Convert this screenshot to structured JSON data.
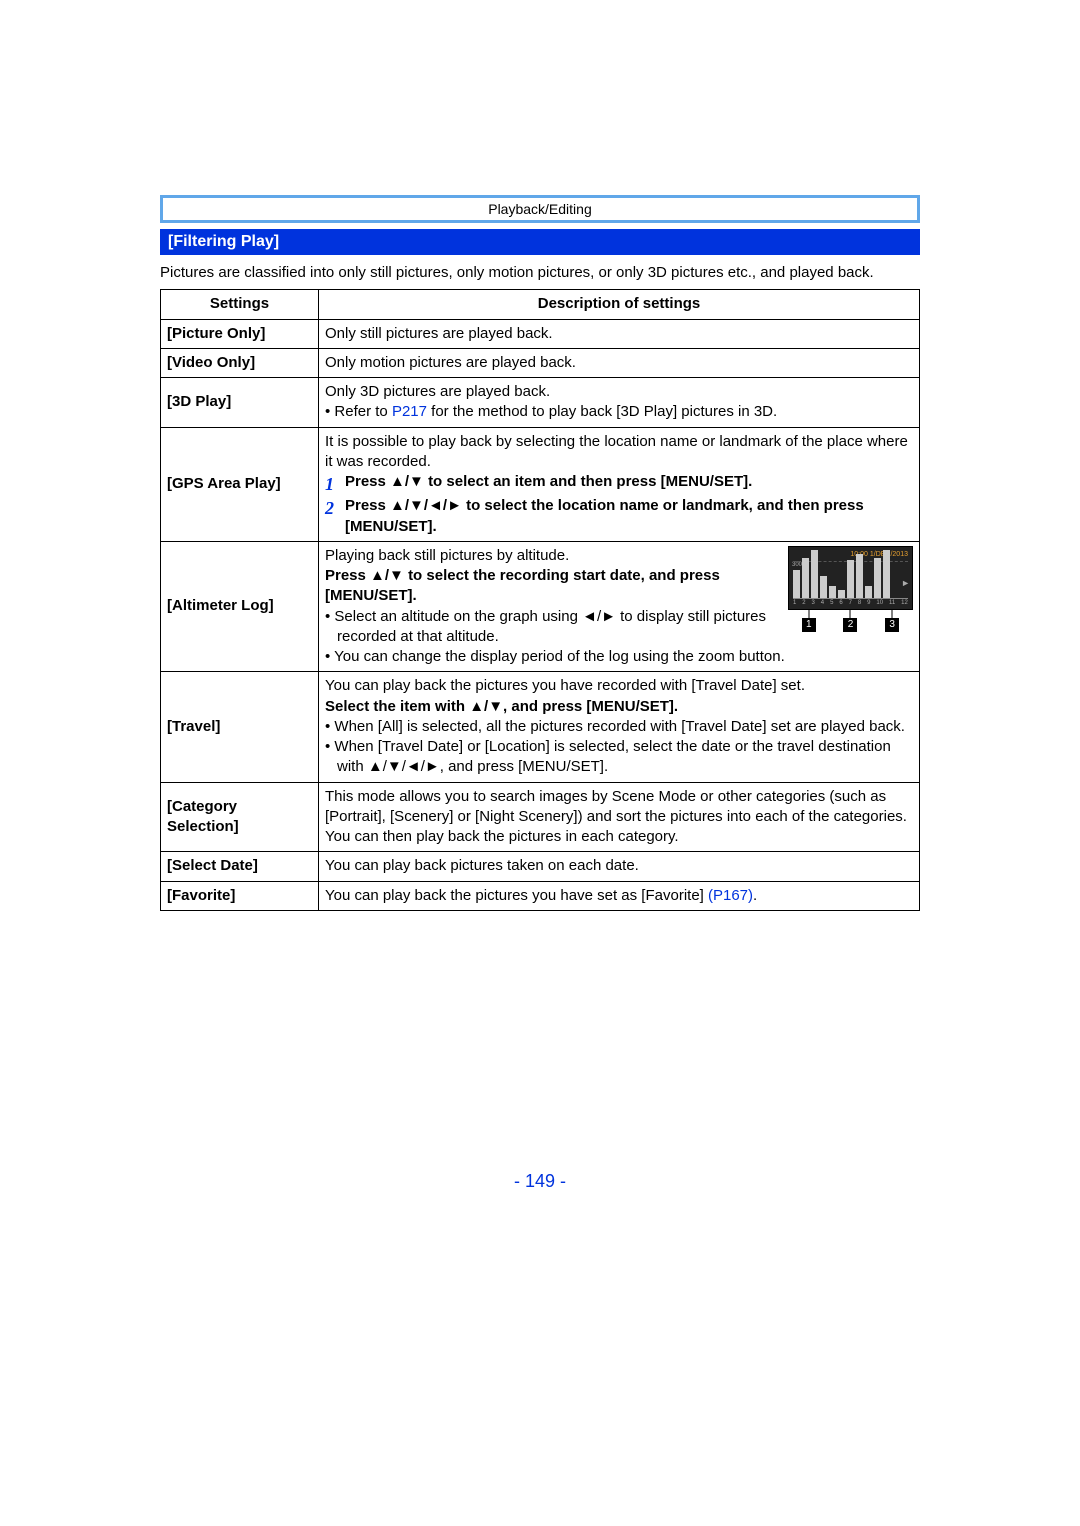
{
  "header": {
    "breadcrumb": "Playback/Editing"
  },
  "section": {
    "title": "[Filtering Play]"
  },
  "intro": "Pictures are classified into only still pictures, only motion pictures, or only 3D pictures etc., and played back.",
  "table": {
    "headers": {
      "settings": "Settings",
      "desc": "Description of settings"
    },
    "picture_only": {
      "label": "[Picture Only]",
      "desc": "Only still pictures are played back."
    },
    "video_only": {
      "label": "[Video Only]",
      "desc": "Only motion pictures are played back."
    },
    "three_d": {
      "label": "[3D Play]",
      "line1": "Only 3D pictures are played back.",
      "bullet_pre": "• Refer to ",
      "link": "P217",
      "bullet_post": " for the method to play back [3D Play] pictures in 3D."
    },
    "gps": {
      "label": "[GPS Area Play]",
      "line1": "It is possible to play back by selecting the location name or landmark of the place where it was recorded.",
      "step1num": "1",
      "step1": "Press ▲/▼ to select an item and then press [MENU/SET].",
      "step2num": "2",
      "step2": "Press ▲/▼/◄/► to select the location name or landmark, and then press [MENU/SET]."
    },
    "altimeter": {
      "label": "[Altimeter Log]",
      "line1": "Playing back still pictures by altitude.",
      "bold1": "Press ▲/▼ to select the recording start date, and press [MENU/SET].",
      "bullet1": "• Select an altitude on the graph using ◄/► to display still pictures recorded at that altitude.",
      "bullet2": "• You can change the display period of the log using the zoom button.",
      "diagram": {
        "time": "10:00  1/DEC/2013",
        "ylabel": "300m",
        "bars": [
          28,
          40,
          48,
          22,
          12,
          8,
          38,
          44,
          12,
          40,
          48
        ],
        "axis": [
          "1",
          "2",
          "3",
          "4",
          "5",
          "6",
          "7",
          "8",
          "9",
          "10",
          "11",
          "12"
        ],
        "callouts": [
          "1",
          "2",
          "3"
        ]
      }
    },
    "travel": {
      "label": "[Travel]",
      "line1": "You can play back the pictures you have recorded with [Travel Date] set.",
      "bold1": "Select the item with ▲/▼, and press [MENU/SET].",
      "bullet1": "• When [All] is selected, all the pictures recorded with [Travel Date] set are played back.",
      "bullet2": "• When [Travel Date] or [Location] is selected, select the date or the travel destination with ▲/▼/◄/►, and press [MENU/SET]."
    },
    "category": {
      "label": "[Category Selection]",
      "desc": "This mode allows you to search images by Scene Mode or other categories (such as [Portrait], [Scenery] or [Night Scenery]) and sort the pictures into each of the categories. You can then play back the pictures in each category."
    },
    "select_date": {
      "label": "[Select Date]",
      "desc": "You can play back pictures taken on each date."
    },
    "favorite": {
      "label": "[Favorite]",
      "desc_pre": "You can play back the pictures you have set as [Favorite] ",
      "link": "(P167)",
      "desc_post": "."
    }
  },
  "page_number": "- 149 -"
}
